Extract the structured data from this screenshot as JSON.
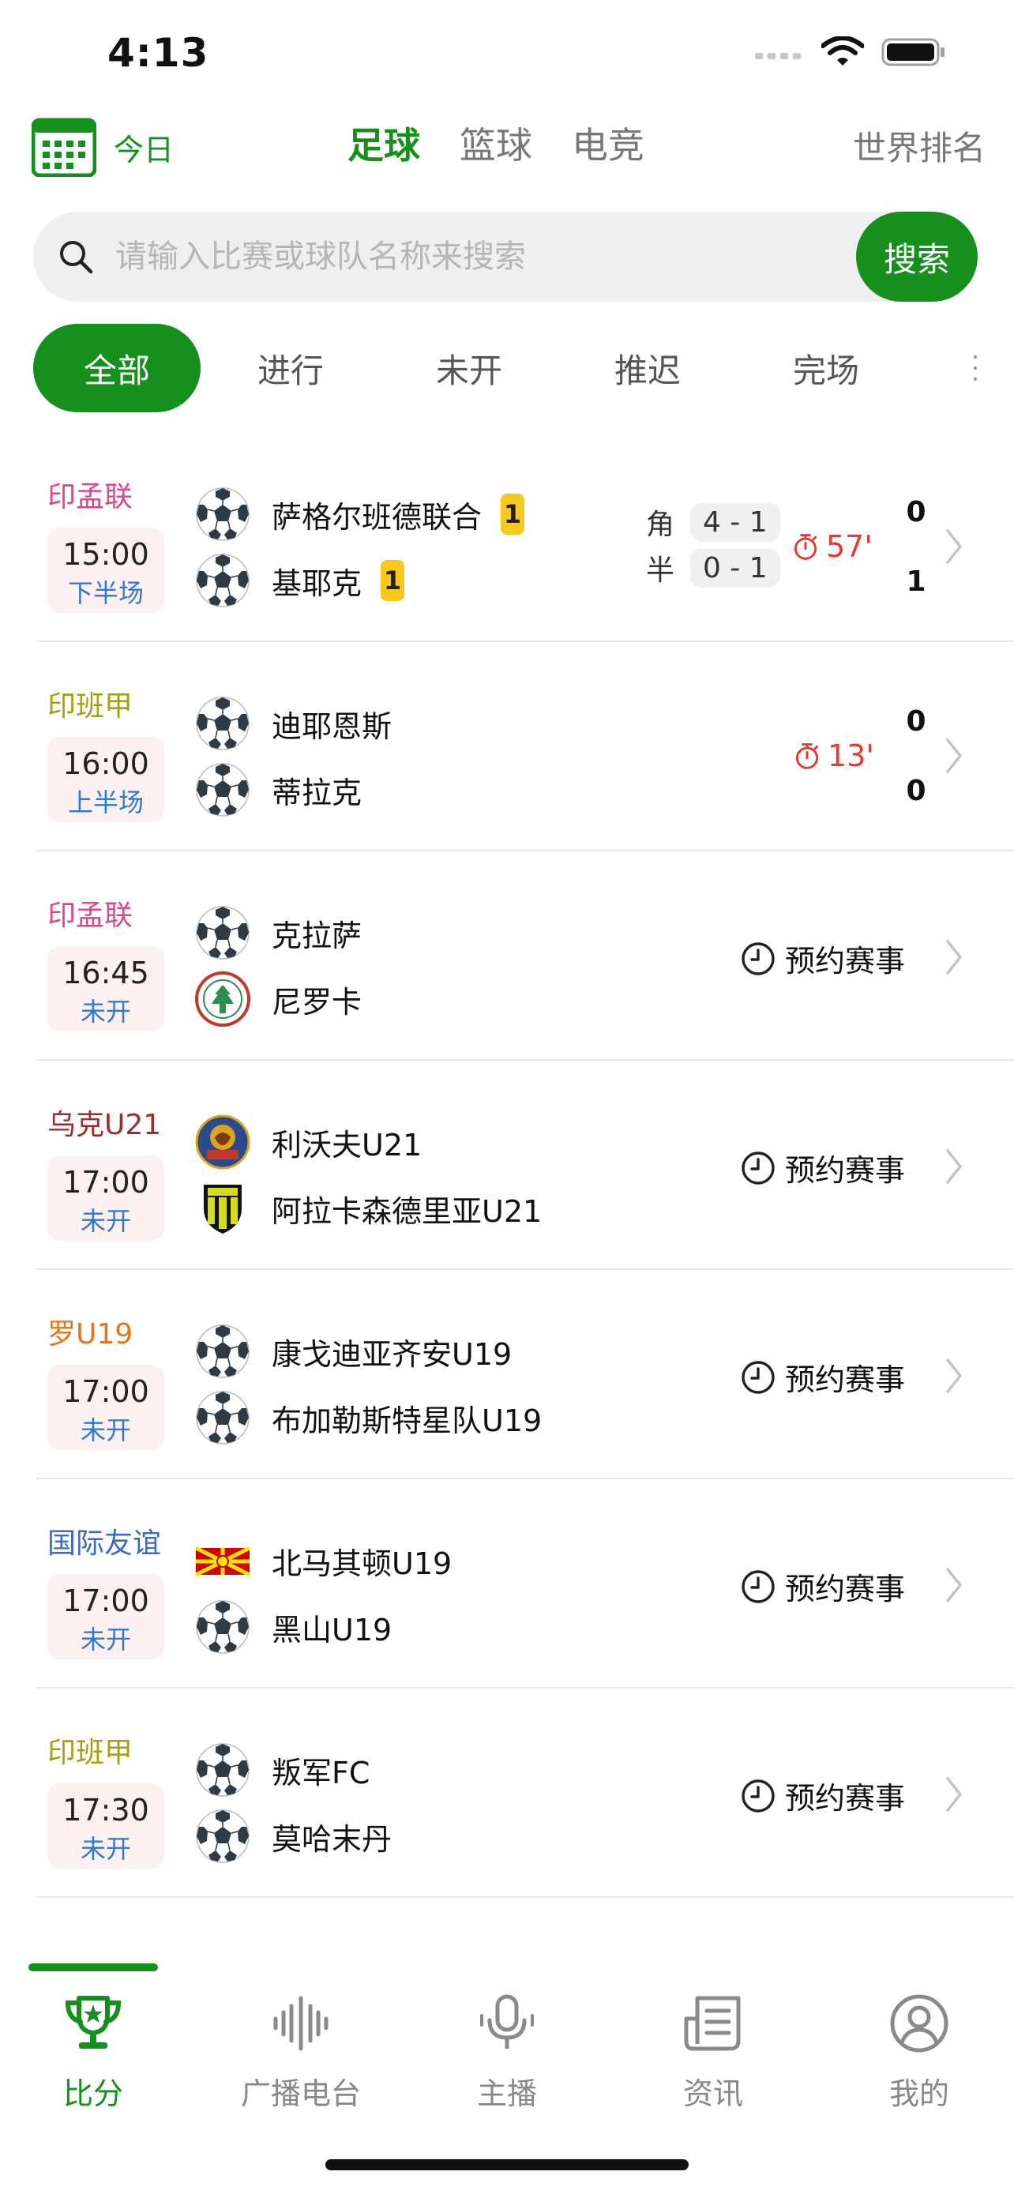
{
  "status_bar": {
    "time": "4:13"
  },
  "header": {
    "calendar_label": "今日",
    "sport_tabs": [
      {
        "label": "足球",
        "active": true
      },
      {
        "label": "篮球",
        "active": false
      },
      {
        "label": "电竞",
        "active": false
      }
    ],
    "world_ranking": "世界排名"
  },
  "search": {
    "placeholder": "请输入比赛或球队名称来搜索",
    "value": "",
    "button": "搜索"
  },
  "filters": [
    {
      "label": "全部",
      "active": true
    },
    {
      "label": "进行",
      "active": false
    },
    {
      "label": "未开",
      "active": false
    },
    {
      "label": "推迟",
      "active": false
    },
    {
      "label": "完场",
      "active": false
    }
  ],
  "colors": {
    "accent": "#15901c",
    "live_red": "#e53a2f",
    "status_blue": "#2e7ad2",
    "league_pink": "#e0458b",
    "league_olive": "#a4a00e",
    "league_maroon": "#9b2d2d",
    "league_orange": "#e0751b",
    "league_blue": "#3c69c4",
    "time_box_bg": "#fdf0f0"
  },
  "matches": [
    {
      "league": "印孟联",
      "league_color": "#e0458b",
      "time": "15:00",
      "status": "下半场",
      "home": {
        "name": "萨格尔班德联合",
        "logo": "soccer-ball-icon",
        "yellow_cards": "1"
      },
      "away": {
        "name": "基耶克",
        "logo": "soccer-ball-icon",
        "yellow_cards": "1"
      },
      "corner_label": "角",
      "corner": "4 - 1",
      "half_label": "半",
      "half": "0 - 1",
      "minute": "57'",
      "home_score": "0",
      "away_score": "1"
    },
    {
      "league": "印班甲",
      "league_color": "#a4a00e",
      "time": "16:00",
      "status": "上半场",
      "home": {
        "name": "迪耶恩斯",
        "logo": "soccer-ball-icon"
      },
      "away": {
        "name": "蒂拉克",
        "logo": "soccer-ball-icon"
      },
      "minute": "13'",
      "home_score": "0",
      "away_score": "0"
    },
    {
      "league": "印孟联",
      "league_color": "#e0458b",
      "time": "16:45",
      "status": "未开",
      "home": {
        "name": "克拉萨",
        "logo": "soccer-ball-icon"
      },
      "away": {
        "name": "尼罗卡",
        "logo": "club-crest-icon"
      },
      "reserve": "预约赛事"
    },
    {
      "league": "乌克U21",
      "league_color": "#9b2d2d",
      "time": "17:00",
      "status": "未开",
      "home": {
        "name": "利沃夫U21",
        "logo": "lion-crest-icon"
      },
      "away": {
        "name": "阿拉卡森德里亚U21",
        "logo": "shield-crest-icon"
      },
      "reserve": "预约赛事"
    },
    {
      "league": "罗U19",
      "league_color": "#e0751b",
      "time": "17:00",
      "status": "未开",
      "home": {
        "name": "康戈迪亚齐安U19",
        "logo": "soccer-ball-icon"
      },
      "away": {
        "name": "布加勒斯特星队U19",
        "logo": "soccer-ball-icon"
      },
      "reserve": "预约赛事"
    },
    {
      "league": "国际友谊",
      "league_color": "#3c69c4",
      "time": "17:00",
      "status": "未开",
      "home": {
        "name": "北马其顿U19",
        "logo": "north-macedonia-flag-icon"
      },
      "away": {
        "name": "黑山U19",
        "logo": "soccer-ball-icon"
      },
      "reserve": "预约赛事"
    },
    {
      "league": "印班甲",
      "league_color": "#a4a00e",
      "time": "17:30",
      "status": "未开",
      "home": {
        "name": "叛军FC",
        "logo": "soccer-ball-icon"
      },
      "away": {
        "name": "莫哈末丹",
        "logo": "soccer-ball-icon"
      },
      "reserve": "预约赛事"
    }
  ],
  "bottom_nav": [
    {
      "label": "比分",
      "icon": "trophy-icon",
      "active": true
    },
    {
      "label": "广播电台",
      "icon": "soundwave-icon",
      "active": false
    },
    {
      "label": "主播",
      "icon": "microphone-icon",
      "active": false
    },
    {
      "label": "资讯",
      "icon": "news-icon",
      "active": false
    },
    {
      "label": "我的",
      "icon": "user-icon",
      "active": false
    }
  ]
}
